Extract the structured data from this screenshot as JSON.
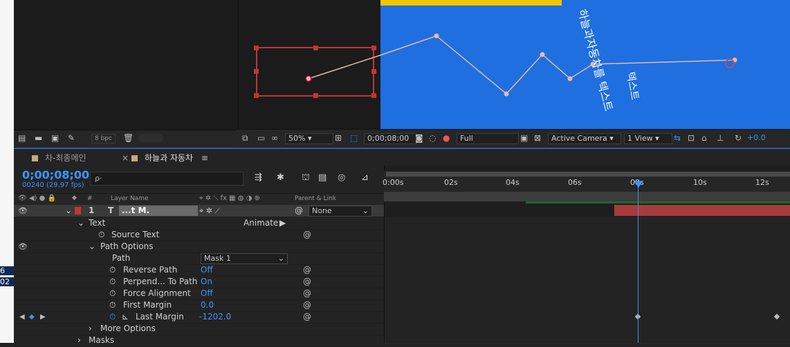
{
  "left_strip": {
    "label_top": "6",
    "label_bottom": "02"
  },
  "project": {
    "bpc": "8 bpc"
  },
  "viewer": {
    "zoom": "50%",
    "timecode": "0;00;08;00",
    "resolution": "Full",
    "camera": "Active Camera",
    "views": "1 View",
    "exposure": "+0.0",
    "comp_text": "하늘과자동차를 텍스트"
  },
  "timeline": {
    "tabs": [
      {
        "label": "차-최종메인",
        "active": false
      },
      {
        "label": "하늘과 자동차",
        "active": true
      }
    ],
    "timecode": "0;00;08;00",
    "fps": "00240 (29.97 fps)",
    "search_placeholder": "ρ·",
    "columns": {
      "layer_name": "Layer Name",
      "parent": "Parent & Link"
    },
    "ruler": [
      "0:00s",
      "02s",
      "04s",
      "06s",
      "08s",
      "10s",
      "12s"
    ],
    "layer": {
      "num": "1",
      "type": "T",
      "name": "...t M.",
      "parent": "None"
    },
    "rows": [
      {
        "label": "Text",
        "value": "",
        "extra": "Animate:"
      },
      {
        "label": "Source Text",
        "value": ""
      },
      {
        "label": "Path Options",
        "value": ""
      },
      {
        "label": "Path",
        "value": "Mask 1"
      },
      {
        "label": "Reverse Path",
        "value": "Off"
      },
      {
        "label": "Perpend... To Path",
        "value": "On"
      },
      {
        "label": "Force Alignment",
        "value": "Off"
      },
      {
        "label": "First Margin",
        "value": "0.0"
      },
      {
        "label": "Last Margin",
        "value": "-1202.0"
      },
      {
        "label": "More Options",
        "value": ""
      },
      {
        "label": "Masks",
        "value": ""
      }
    ]
  }
}
